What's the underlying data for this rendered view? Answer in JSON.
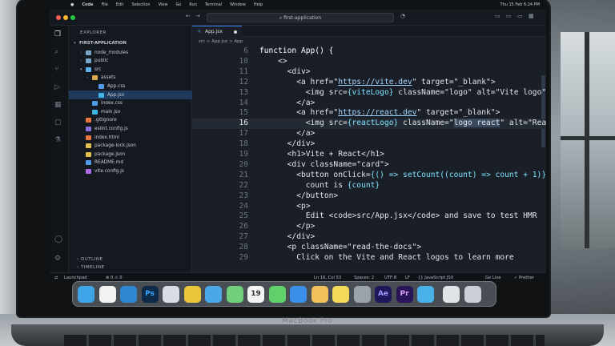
{
  "menubar": {
    "items": [
      "Code",
      "File",
      "Edit",
      "Selection",
      "View",
      "Go",
      "Run",
      "Terminal",
      "Window",
      "Help"
    ],
    "clock": "Thu 15 Feb 6:24 PM"
  },
  "titlebar": {
    "search_text": "first-application"
  },
  "sidebar": {
    "header": "EXPLORER",
    "project": "FIRST-APPLICATION",
    "items": [
      {
        "label": "node_modules",
        "kind": "folder",
        "color": "#7aa7c7"
      },
      {
        "label": "public",
        "kind": "folder",
        "color": "#7aa7c7"
      },
      {
        "label": "src",
        "kind": "folder-open",
        "color": "#5fb0e8"
      },
      {
        "label": "assets",
        "kind": "folder",
        "color": "#d7a84f"
      },
      {
        "label": "App.css",
        "kind": "file",
        "color": "#4f9be8"
      },
      {
        "label": "App.jsx",
        "kind": "file",
        "color": "#3fb5e5",
        "active": true
      },
      {
        "label": "index.css",
        "kind": "file",
        "color": "#4f9be8"
      },
      {
        "label": "main.jsx",
        "kind": "file",
        "color": "#3fb5e5"
      },
      {
        "label": ".gitignore",
        "kind": "file",
        "color": "#e8763f"
      },
      {
        "label": "eslint.config.js",
        "kind": "file",
        "color": "#8a6fe0"
      },
      {
        "label": "index.html",
        "kind": "file",
        "color": "#e8763f"
      },
      {
        "label": "package-lock.json",
        "kind": "file",
        "color": "#e2c04b"
      },
      {
        "label": "package.json",
        "kind": "file",
        "color": "#e2c04b"
      },
      {
        "label": "README.md",
        "kind": "file",
        "color": "#4f9be8"
      },
      {
        "label": "vite.config.js",
        "kind": "file",
        "color": "#b06ae8"
      }
    ],
    "outline": "OUTLINE",
    "timeline": "TIMELINE"
  },
  "editor": {
    "tab": "App.jsx",
    "breadcrumb": "src > App.jsx > App",
    "lines": [
      {
        "n": "6",
        "segs": [
          [
            "t-kw",
            "function App() {"
          ]
        ]
      },
      {
        "n": "10",
        "segs": [
          [
            "",
            "    <>"
          ]
        ]
      },
      {
        "n": "11",
        "segs": [
          [
            "",
            "      <div>"
          ]
        ]
      },
      {
        "n": "12",
        "segs": [
          [
            "",
            "        <a href=\""
          ],
          [
            "t-url",
            "https://vite.dev"
          ],
          [
            "",
            "\" target=\"_blank\">"
          ]
        ]
      },
      {
        "n": "13",
        "segs": [
          [
            "",
            "          <img src="
          ],
          [
            "t-brace",
            "{viteLogo}"
          ],
          [
            "",
            " className=\"logo\" alt=\"Vite logo\" />"
          ]
        ]
      },
      {
        "n": "14",
        "segs": [
          [
            "",
            "        </a>"
          ]
        ]
      },
      {
        "n": "15",
        "segs": [
          [
            "",
            "        <a href=\""
          ],
          [
            "t-url",
            "https://react.dev"
          ],
          [
            "",
            "\" target=\"_blank\">"
          ]
        ]
      },
      {
        "n": "16",
        "segs": [
          [
            "",
            "          <img src="
          ],
          [
            "t-brace",
            "{reactLogo}"
          ],
          [
            "",
            " className=\""
          ],
          [
            "t-sel",
            "logo react"
          ],
          [
            "",
            "\" alt=\"React logo\" />"
          ]
        ],
        "current": true
      },
      {
        "n": "17",
        "segs": [
          [
            "",
            "        </a>"
          ]
        ]
      },
      {
        "n": "18",
        "segs": [
          [
            "",
            "      </div>"
          ]
        ]
      },
      {
        "n": "19",
        "segs": [
          [
            "",
            "      <h1>Vite + React</h1>"
          ]
        ]
      },
      {
        "n": "20",
        "segs": [
          [
            "",
            "      <div className=\"card\">"
          ]
        ]
      },
      {
        "n": "21",
        "segs": [
          [
            "",
            "        <button onClick="
          ],
          [
            "t-brace",
            "{() => setCount((count) => count + 1)}"
          ],
          [
            "",
            ">"
          ]
        ]
      },
      {
        "n": "22",
        "segs": [
          [
            "",
            "          count is "
          ],
          [
            "t-brace",
            "{count}"
          ]
        ]
      },
      {
        "n": "23",
        "segs": [
          [
            "",
            "        </button>"
          ]
        ]
      },
      {
        "n": "24",
        "segs": [
          [
            "",
            "        <p>"
          ]
        ]
      },
      {
        "n": "25",
        "segs": [
          [
            "",
            "          Edit <code>src/App.jsx</code> and save to test HMR"
          ]
        ]
      },
      {
        "n": "26",
        "segs": [
          [
            "",
            "        </p>"
          ]
        ]
      },
      {
        "n": "27",
        "segs": [
          [
            "",
            "      </div>"
          ]
        ]
      },
      {
        "n": "28",
        "segs": [
          [
            "",
            "      <p className=\"read-the-docs\">"
          ]
        ]
      },
      {
        "n": "29",
        "segs": [
          [
            "",
            "        Click on the Vite and React logos to learn more"
          ]
        ]
      }
    ]
  },
  "status": {
    "branch": "Launchpad",
    "problems": "⊗ 0  ⚠ 0",
    "position": "Ln 16, Col 53",
    "spaces": "Spaces: 2",
    "encoding": "UTF-8",
    "eol": "LF",
    "language": "{} JavaScript JSX",
    "golive": "Go Live",
    "prettier": "✓ Prettier"
  },
  "dock": {
    "icons": [
      {
        "name": "finder-icon",
        "color": "#3fa4e8"
      },
      {
        "name": "notion-icon",
        "color": "#f2f2f2"
      },
      {
        "name": "vscode-icon",
        "color": "#2f86d3"
      },
      {
        "name": "photoshop-icon",
        "color": "#0f2a48"
      },
      {
        "name": "launchpad-icon",
        "color": "#d8dde3"
      },
      {
        "name": "chrome-icon",
        "color": "#e9c53a"
      },
      {
        "name": "safari-icon",
        "color": "#4aa8e8"
      },
      {
        "name": "maps-icon",
        "color": "#6fcf7a"
      },
      {
        "name": "calendar-icon",
        "color": "#f4f4f4"
      },
      {
        "name": "messages-icon",
        "color": "#5fd06a"
      },
      {
        "name": "appstore-icon",
        "color": "#3a8fe8"
      },
      {
        "name": "photos-icon",
        "color": "#f0c05a"
      },
      {
        "name": "notes-icon",
        "color": "#f3d95a"
      },
      {
        "name": "settings-icon",
        "color": "#9aa2aa"
      },
      {
        "name": "aftereffects-icon",
        "color": "#20165a"
      },
      {
        "name": "premiere-icon",
        "color": "#2a1558"
      },
      {
        "name": "telegram-icon",
        "color": "#4ab0e8"
      },
      {
        "name": "folder-icon",
        "color": "#dfe4e8"
      },
      {
        "name": "trash-icon",
        "color": "#c9cfd4"
      }
    ],
    "calendar_day": "19",
    "ps_label": "Ps",
    "ae_label": "Ae",
    "pr_label": "Pr"
  },
  "laptop_label": "MacBook Pro"
}
